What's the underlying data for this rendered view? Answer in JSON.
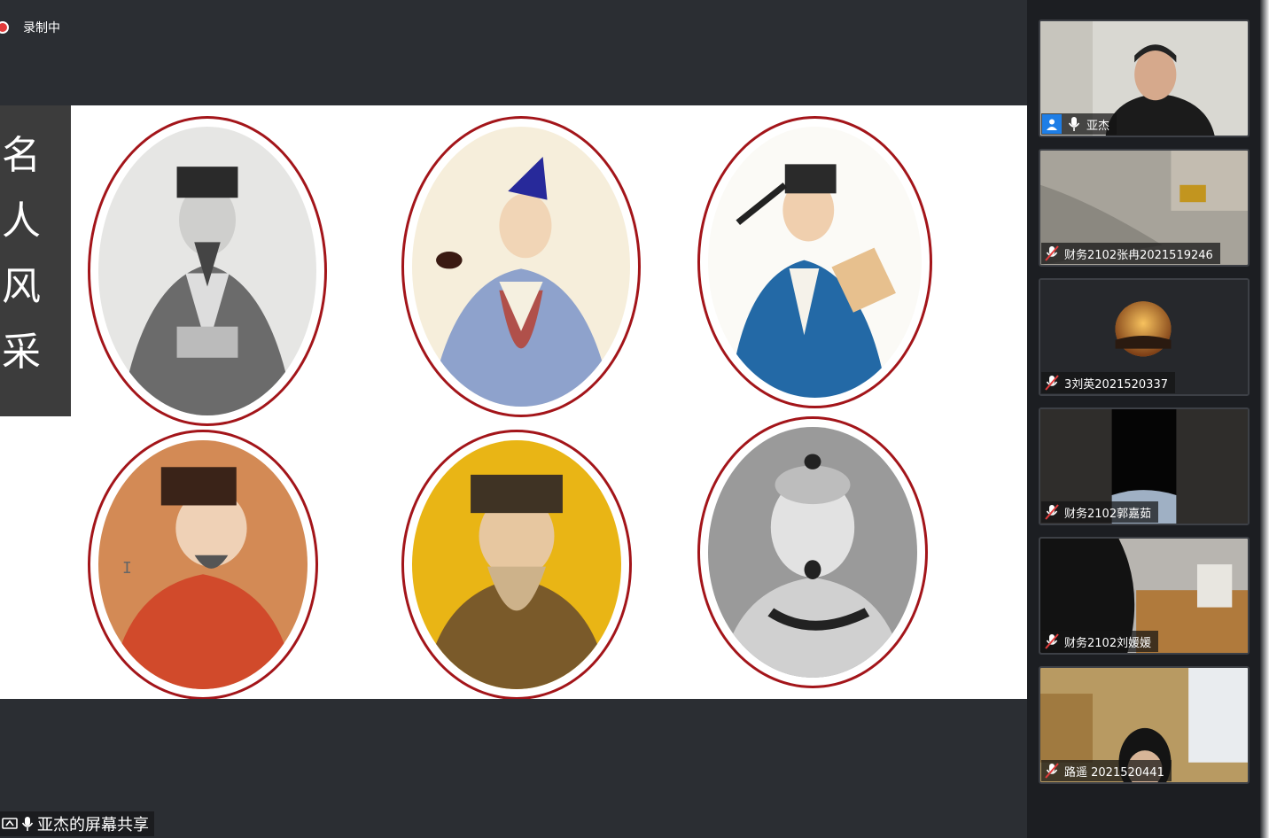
{
  "recording": {
    "label": "录制中"
  },
  "slide": {
    "title_chars": [
      "名",
      "人",
      "风",
      "采"
    ]
  },
  "participants": [
    {
      "name": "亚杰",
      "host": true
    },
    {
      "name": "财务2102张冉2021519246"
    },
    {
      "name": "3刘英2021520337"
    },
    {
      "name": "财务2102郭嘉茹"
    },
    {
      "name": "财务2102刘媛媛"
    },
    {
      "name": "路遥 2021520441"
    }
  ],
  "screen_share": {
    "label": "亚杰的屏幕共享"
  },
  "colors": {
    "frame_red": "#a3151a",
    "host_blue": "#1e7ee6",
    "rec_red": "#e23b3b"
  }
}
